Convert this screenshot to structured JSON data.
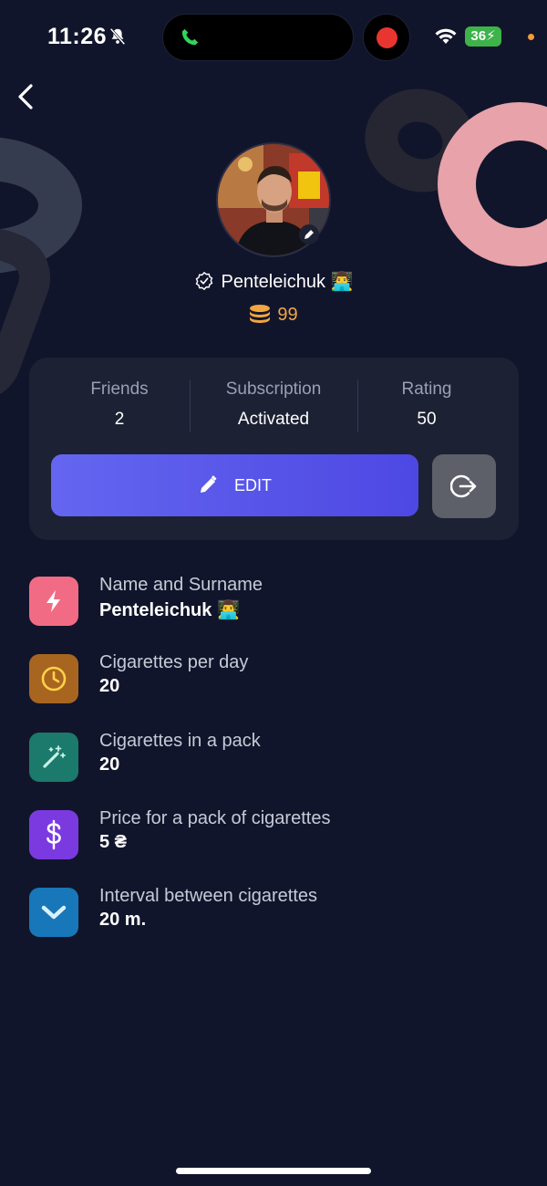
{
  "status_bar": {
    "time": "11:26",
    "battery": "36",
    "icons": [
      "bell-muted-icon",
      "phone-icon",
      "record-icon",
      "wifi-icon",
      "battery-icon"
    ]
  },
  "header": {
    "back_icon": "chevron-left-icon"
  },
  "profile": {
    "username": "Penteleichuk",
    "coins": "99",
    "verified_icon": "verified-badge-icon",
    "coin_icon": "coin-stack-icon"
  },
  "stats": [
    {
      "label": "Friends",
      "value": "2"
    },
    {
      "label": "Subscription",
      "value": "Activated"
    },
    {
      "label": "Rating",
      "value": "50"
    }
  ],
  "actions": {
    "edit_label": "EDIT",
    "logout_icon": "logout-icon"
  },
  "info": [
    {
      "label": "Name and Surname",
      "value": "Penteleichuk",
      "icon": "lightning-icon",
      "color": "#f26b85"
    },
    {
      "label": "Cigarettes per day",
      "value": "20",
      "icon": "clock-icon",
      "color": "#a8651f"
    },
    {
      "label": "Cigarettes in a pack",
      "value": "20",
      "icon": "magic-wand-icon",
      "color": "#1b7a6b"
    },
    {
      "label": "Price for a pack of cigarettes",
      "value": "5 ₴",
      "icon": "dollar-icon",
      "color": "#7b3ae0"
    },
    {
      "label": "Interval between cigarettes",
      "value": "20 m.",
      "icon": "chevron-down-icon",
      "color": "#1877b8"
    }
  ],
  "colors": {
    "background": "#11152b",
    "card": "#1c2133",
    "accent": "#5b5bf0",
    "coins": "#f2a640"
  }
}
